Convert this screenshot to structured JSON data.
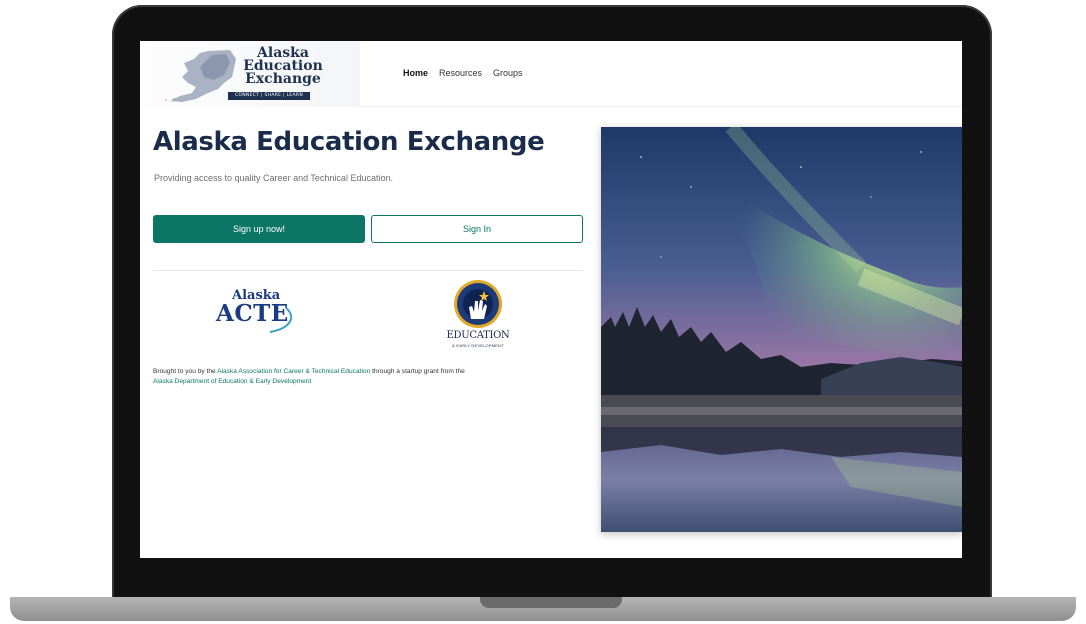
{
  "header": {
    "logo": {
      "line1": "Alaska",
      "line2": "Education",
      "line3": "Exchange",
      "tagline": "CONNECT | SHARE | LEARN"
    },
    "nav": [
      {
        "label": "Home",
        "active": true
      },
      {
        "label": "Resources",
        "active": false
      },
      {
        "label": "Groups",
        "active": false
      }
    ]
  },
  "hero": {
    "title": "Alaska Education Exchange",
    "subtitle": "Providing access to quality Career and Technical Education.",
    "primary_button": "Sign up now!",
    "secondary_button": "Sign In"
  },
  "partners": {
    "acte": {
      "line1": "Alaska",
      "line2": "ACTE"
    },
    "education": {
      "word": "EDUCATION",
      "sub": "& EARLY DEVELOPMENT"
    }
  },
  "credits": {
    "prefix": "Brought to you by the ",
    "link1": "Alaska Association for Career & Technical Education",
    "middle": " through a startup grant from the",
    "link2": "Alaska Department of Education & Early Development"
  },
  "colors": {
    "accent": "#0c7666",
    "title": "#1b2b4a"
  },
  "icons": {
    "logo_map": "alaska-map-icon",
    "education_seal": "education-seal-icon"
  }
}
